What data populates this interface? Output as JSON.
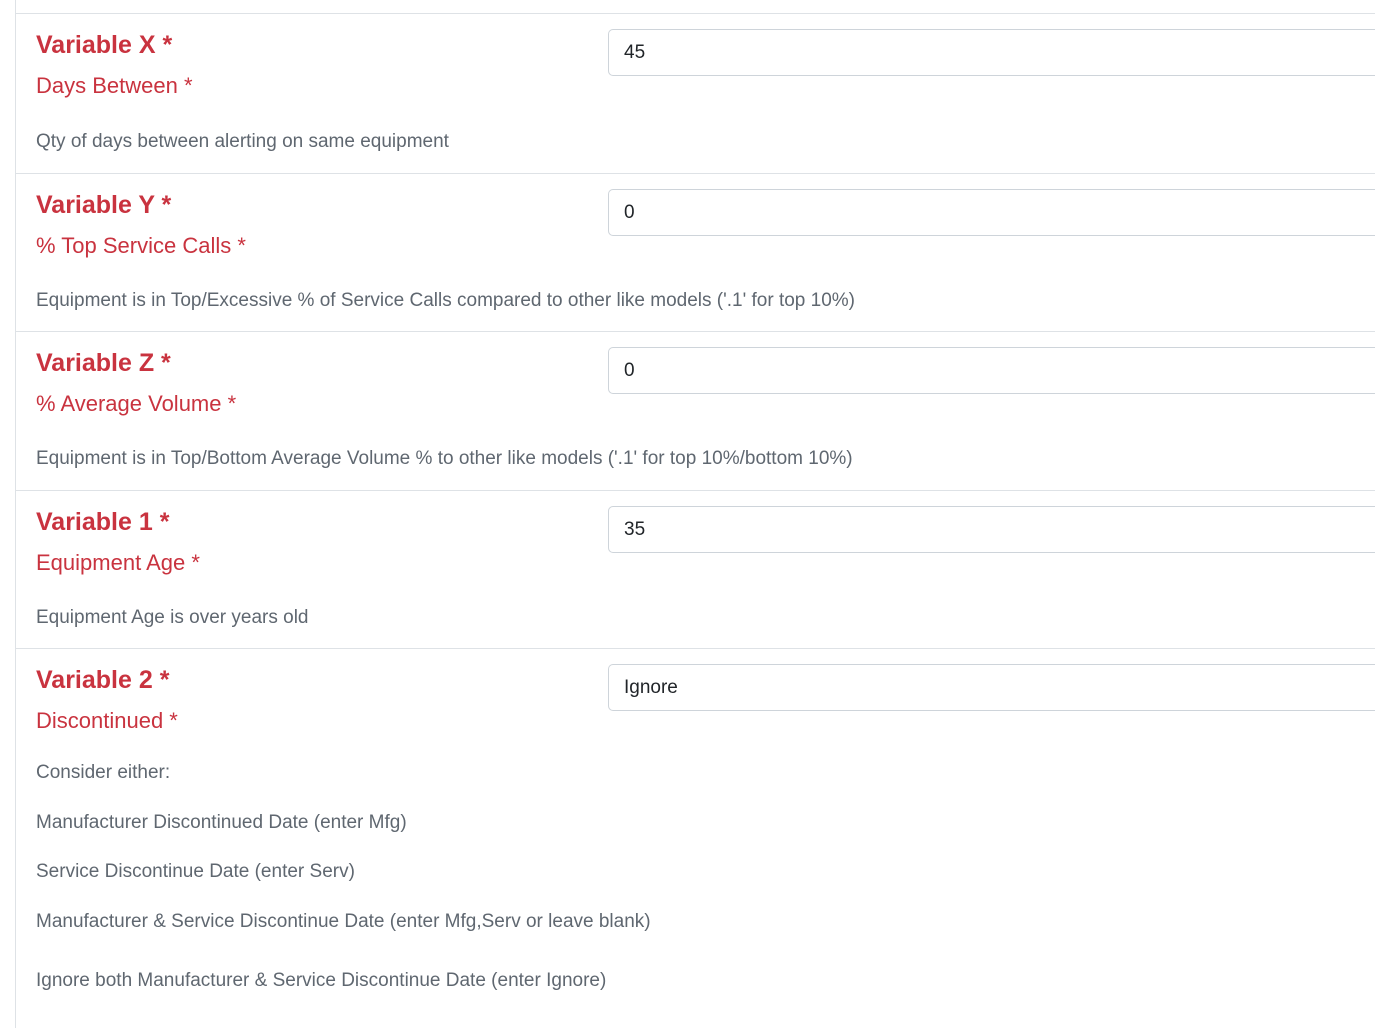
{
  "settings": [
    {
      "title": "Variable X *",
      "subtitle": "Days Between *",
      "value": "45",
      "description": "Qty of days between alerting on same equipment"
    },
    {
      "title": "Variable Y *",
      "subtitle": "% Top Service Calls *",
      "value": "0",
      "description": "Equipment is in Top/Excessive % of Service Calls compared to other like models ('.1' for top 10%)"
    },
    {
      "title": "Variable Z *",
      "subtitle": "% Average Volume *",
      "value": "0",
      "description": "Equipment is in Top/Bottom Average Volume % to other like models ('.1' for top 10%/bottom 10%)"
    },
    {
      "title": "Variable 1 *",
      "subtitle": "Equipment Age *",
      "value": "35",
      "description": "Equipment Age is over years old"
    },
    {
      "title": "Variable 2 *",
      "subtitle": "Discontinued *",
      "value": "Ignore",
      "description_lines": [
        "Consider either:",
        "Manufacturer Discontinued Date (enter Mfg)",
        "Service Discontinue Date (enter Serv)",
        "Manufacturer & Service Discontinue Date (enter Mfg,Serv or leave blank)",
        "Ignore both Manufacturer & Service Discontinue Date (enter Ignore)"
      ]
    }
  ],
  "colors": {
    "label_red": "#c9333f",
    "description_gray": "#5f6770",
    "border": "#dee2e6"
  }
}
